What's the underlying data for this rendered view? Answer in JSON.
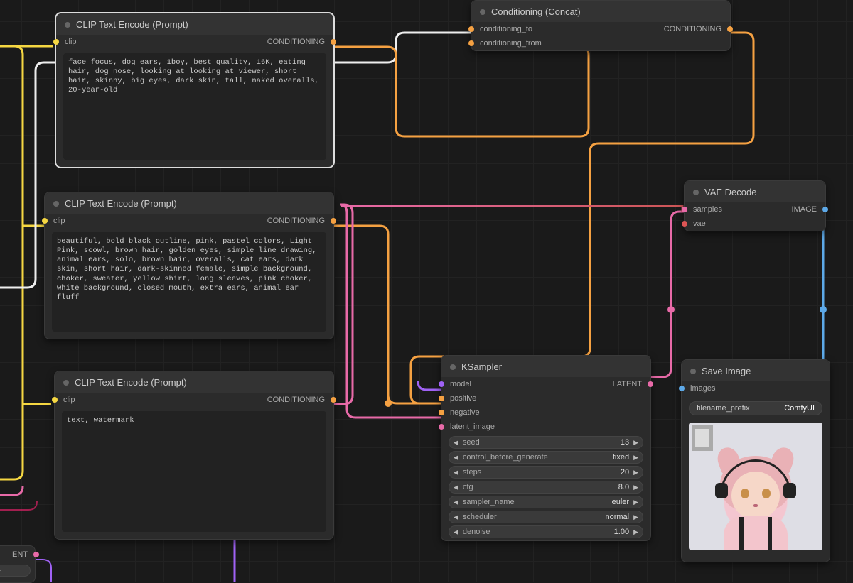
{
  "nodes": {
    "clip1": {
      "title": "CLIP Text Encode (Prompt)",
      "input_label": "clip",
      "output_label": "CONDITIONING",
      "text": "face focus, dog ears, 1boy, best quality, 16K, eating hair, dog nose, looking at looking at viewer, short hair, skinny, big eyes, dark skin, tall, naked overalls, 20-year-old"
    },
    "clip2": {
      "title": "CLIP Text Encode (Prompt)",
      "input_label": "clip",
      "output_label": "CONDITIONING",
      "text": "beautiful, bold black outline, pink, pastel colors, Light Pink, scowl, brown hair, golden eyes, simple line drawing, animal ears, solo, brown hair, overalls, cat ears, dark skin, short hair, dark-skinned female, simple background, choker, sweater, yellow shirt, long sleeves, pink choker, white background, closed mouth, extra ears, animal ear fluff"
    },
    "clip3": {
      "title": "CLIP Text Encode (Prompt)",
      "input_label": "clip",
      "output_label": "CONDITIONING",
      "text": "text, watermark"
    },
    "concat": {
      "title": "Conditioning (Concat)",
      "in1": "conditioning_to",
      "in2": "conditioning_from",
      "out": "CONDITIONING"
    },
    "ksampler": {
      "title": "KSampler",
      "in_model": "model",
      "in_positive": "positive",
      "in_negative": "negative",
      "in_latent": "latent_image",
      "out": "LATENT",
      "params": [
        {
          "name": "seed",
          "value": "13"
        },
        {
          "name": "control_before_generate",
          "value": "fixed"
        },
        {
          "name": "steps",
          "value": "20"
        },
        {
          "name": "cfg",
          "value": "8.0"
        },
        {
          "name": "sampler_name",
          "value": "euler"
        },
        {
          "name": "scheduler",
          "value": "normal"
        },
        {
          "name": "denoise",
          "value": "1.00"
        }
      ]
    },
    "vae": {
      "title": "VAE Decode",
      "in_samples": "samples",
      "in_vae": "vae",
      "out": "IMAGE"
    },
    "save": {
      "title": "Save Image",
      "in_images": "images",
      "prefix_label": "filename_prefix",
      "prefix_value": "ComfyUI"
    },
    "partial": {
      "out": "ENT"
    }
  }
}
